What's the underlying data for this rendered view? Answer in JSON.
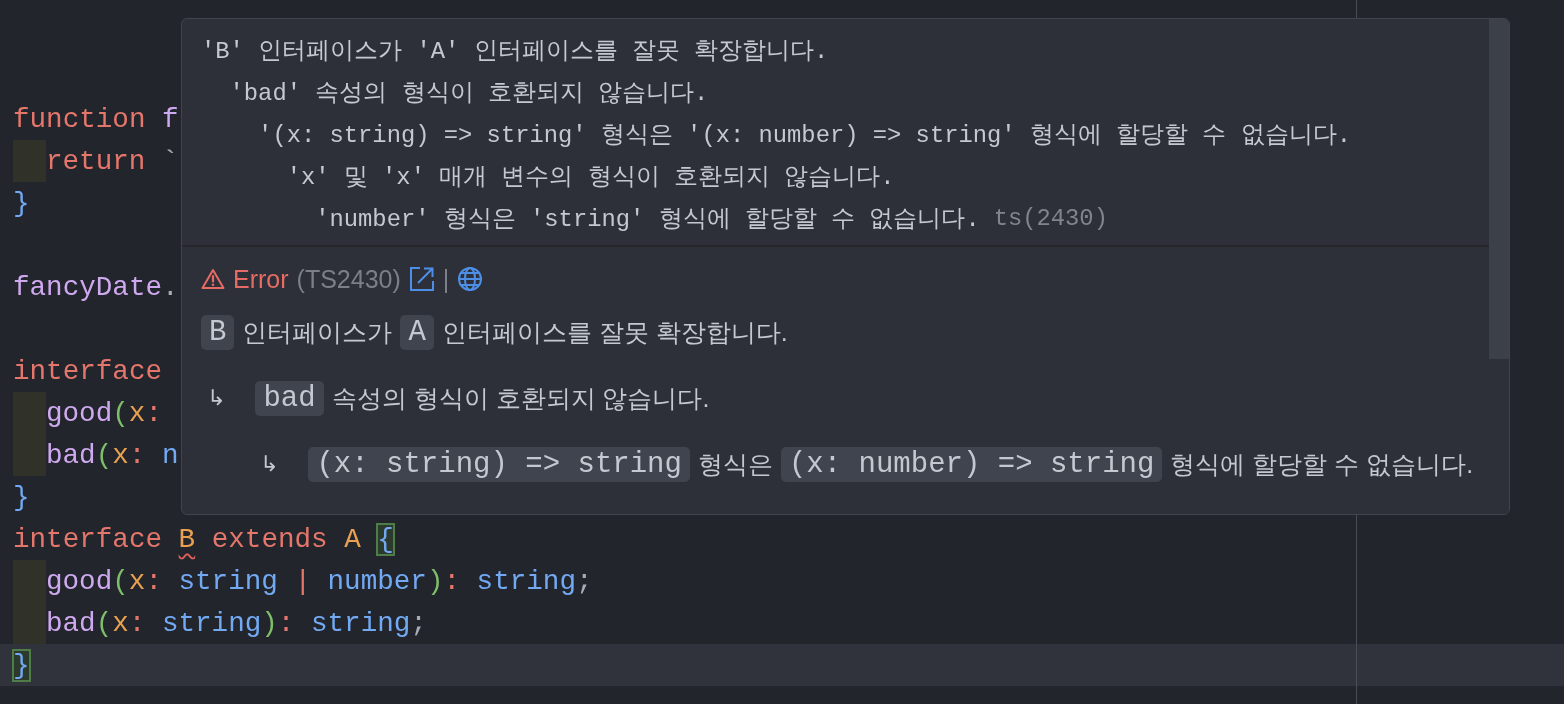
{
  "editor": {
    "lines": [
      {
        "indented": false,
        "active": false
      },
      {
        "indented": false,
        "active": false
      },
      {
        "indented": false,
        "active": false,
        "tokens": [
          {
            "kind": "keyword",
            "text": "function"
          },
          {
            "kind": "name",
            "text": " f"
          }
        ]
      },
      {
        "indented": true,
        "active": false,
        "tokens": [
          {
            "kind": "keyword",
            "text": "return"
          },
          {
            "kind": "punct",
            "text": " `"
          }
        ]
      },
      {
        "indented": false,
        "active": false,
        "tokens": [
          {
            "kind": "type",
            "text": "}"
          }
        ]
      },
      {
        "indented": false,
        "active": false
      },
      {
        "indented": false,
        "active": false,
        "tokens": [
          {
            "kind": "name",
            "text": "fancyDate"
          },
          {
            "kind": "punct",
            "text": "."
          }
        ]
      },
      {
        "indented": false,
        "active": false
      },
      {
        "indented": false,
        "active": false,
        "tokens": [
          {
            "kind": "keyword",
            "text": "interface"
          }
        ]
      },
      {
        "indented": true,
        "active": false,
        "tokens": [
          {
            "kind": "name",
            "text": "good"
          },
          {
            "kind": "paren",
            "text": "("
          },
          {
            "kind": "param",
            "text": "x"
          },
          {
            "kind": "operator",
            "text": ":"
          }
        ]
      },
      {
        "indented": true,
        "active": false,
        "tokens": [
          {
            "kind": "name",
            "text": "bad"
          },
          {
            "kind": "paren",
            "text": "("
          },
          {
            "kind": "param",
            "text": "x"
          },
          {
            "kind": "operator",
            "text": ":"
          },
          {
            "kind": "type",
            "text": " n"
          }
        ]
      },
      {
        "indented": false,
        "active": false,
        "tokens": [
          {
            "kind": "type",
            "text": "}"
          }
        ]
      },
      {
        "indented": false,
        "active": false,
        "tokens": [
          {
            "kind": "keyword",
            "text": "interface"
          },
          {
            "kind": "param",
            "text": " B",
            "error": true
          },
          {
            "kind": "keyword",
            "text": " extends"
          },
          {
            "kind": "param",
            "text": " A"
          },
          {
            "kind": "type",
            "text": " {",
            "matched": true
          }
        ]
      },
      {
        "indented": true,
        "active": false,
        "tokens": [
          {
            "kind": "name",
            "text": "good"
          },
          {
            "kind": "paren",
            "text": "("
          },
          {
            "kind": "param",
            "text": "x"
          },
          {
            "kind": "operator",
            "text": ":"
          },
          {
            "kind": "type",
            "text": " string"
          },
          {
            "kind": "operator",
            "text": " |"
          },
          {
            "kind": "type",
            "text": " number"
          },
          {
            "kind": "paren",
            "text": ")"
          },
          {
            "kind": "operator",
            "text": ":"
          },
          {
            "kind": "type",
            "text": " string"
          },
          {
            "kind": "punct",
            "text": ";"
          }
        ]
      },
      {
        "indented": true,
        "active": false,
        "tokens": [
          {
            "kind": "name",
            "text": "bad"
          },
          {
            "kind": "paren",
            "text": "("
          },
          {
            "kind": "param",
            "text": "x"
          },
          {
            "kind": "operator",
            "text": ":"
          },
          {
            "kind": "type",
            "text": " string"
          },
          {
            "kind": "paren",
            "text": ")"
          },
          {
            "kind": "operator",
            "text": ":"
          },
          {
            "kind": "type",
            "text": " string"
          },
          {
            "kind": "punct",
            "text": ";"
          }
        ]
      },
      {
        "indented": false,
        "active": true,
        "tokens": [
          {
            "kind": "type",
            "text": "}",
            "matched": true
          }
        ]
      }
    ]
  },
  "hover": {
    "messages": [
      {
        "text": "'B' 인터페이스가 'A' 인터페이스를 잘못 확장합니다.",
        "children": [
          {
            "text": "'bad' 속성의 형식이 호환되지 않습니다.",
            "children": [
              {
                "text": "'(x: string) => string' 형식은 '(x: number) => string' 형식에 할당할 수 없습니다.",
                "children": [
                  {
                    "text": "'x' 및 'x' 매개 변수의 형식이 호환되지 않습니다.",
                    "children": [
                      {
                        "text": "'number' 형식은 'string' 형식에 할당할 수 없습니다.",
                        "source": "ts(2430)"
                      }
                    ]
                  }
                ]
              }
            ]
          }
        ]
      }
    ],
    "severity_label": "Error",
    "code": "(TS2430)",
    "separator": "|",
    "details": [
      {
        "parts": [
          {
            "kind": "code",
            "text": "B"
          },
          {
            "kind": "text",
            "text": "인터페이스가"
          },
          {
            "kind": "code",
            "text": "A"
          },
          {
            "kind": "text",
            "text": "인터페이스를 잘못 확장합니다."
          }
        ],
        "children": [
          {
            "arrow": "↳",
            "parts": [
              {
                "kind": "code",
                "text": "bad"
              },
              {
                "kind": "text",
                "text": "속성의 형식이 호환되지 않습니다."
              }
            ],
            "children": [
              {
                "arrow": "↳",
                "parts": [
                  {
                    "kind": "code",
                    "text": "(x: string) => string"
                  },
                  {
                    "kind": "text",
                    "text": "형식은"
                  },
                  {
                    "kind": "code",
                    "text": "(x: number) => string"
                  },
                  {
                    "kind": "text",
                    "text": "형식에 할당할 수 없습니다."
                  }
                ]
              }
            ]
          }
        ]
      }
    ]
  }
}
